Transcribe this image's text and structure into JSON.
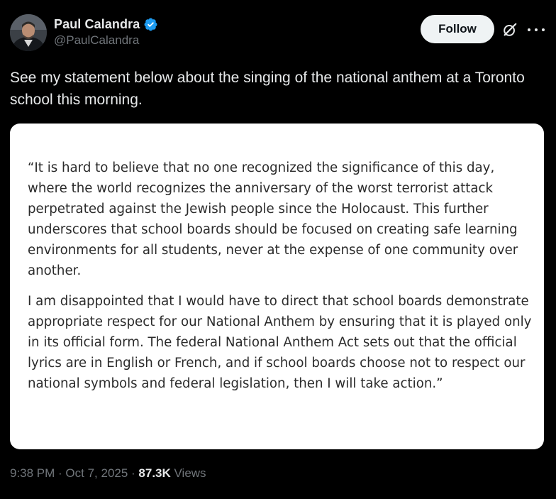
{
  "author": {
    "display_name": "Paul Calandra",
    "handle": "@PaulCalandra",
    "verified_icon": "verified-badge-icon",
    "verified_color": "#1d9bf0"
  },
  "actions": {
    "follow_label": "Follow",
    "grok_icon": "grok-icon",
    "more_icon": "more-icon"
  },
  "tweet": {
    "text": "See my statement below about the singing of the national anthem at a Toronto school this morning."
  },
  "image": {
    "paragraph_1": "“It is hard to believe that no one recognized the significance of this day, where the world recognizes the anniversary of the worst terrorist attack perpetrated against the Jewish people since the Holocaust. This further underscores that school boards should be focused on creating safe learning environments for all students, never at the expense of one community over another.",
    "paragraph_2": "I am disappointed that I would have to direct that school boards demonstrate appropriate respect for our National Anthem by ensuring that it is played only in its official form. The federal National Anthem Act sets out that the official lyrics are in English or French, and if school boards choose not to respect our national symbols and federal legislation, then I will take action.”"
  },
  "meta": {
    "time": "9:38 PM",
    "separator": " · ",
    "date": "Oct 7, 2025",
    "views_count": "87.3K",
    "views_label": " Views"
  },
  "colors": {
    "background": "#000000",
    "primary_text": "#e7e9ea",
    "secondary_text": "#71767b",
    "follow_button_bg": "#eff3f4"
  }
}
